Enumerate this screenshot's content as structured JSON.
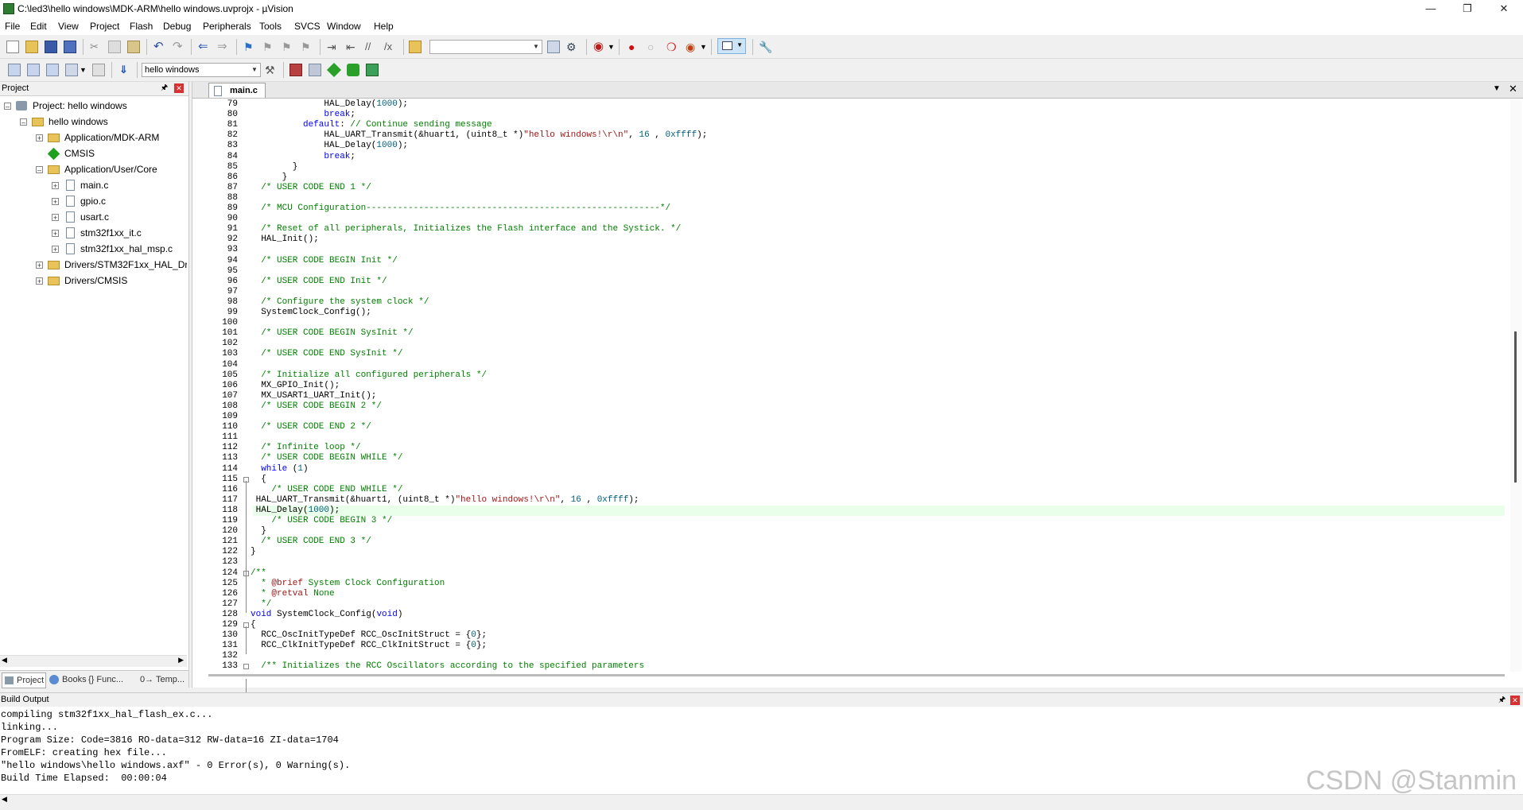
{
  "window": {
    "title": "C:\\led3\\hello windows\\MDK-ARM\\hello windows.uvprojx - µVision"
  },
  "menu": [
    "File",
    "Edit",
    "View",
    "Project",
    "Flash",
    "Debug",
    "Peripherals",
    "Tools",
    "SVCS",
    "Window",
    "Help"
  ],
  "toolbar2": {
    "target_select": "hello windows"
  },
  "project_panel": {
    "title": "Project",
    "tree": {
      "root": "Project: hello windows",
      "target": "hello windows",
      "groups": [
        {
          "label": "Application/MDK-ARM"
        },
        {
          "label": "CMSIS"
        },
        {
          "label": "Application/User/Core",
          "files": [
            "main.c",
            "gpio.c",
            "usart.c",
            "stm32f1xx_it.c",
            "stm32f1xx_hal_msp.c"
          ]
        },
        {
          "label": "Drivers/STM32F1xx_HAL_Driv"
        },
        {
          "label": "Drivers/CMSIS"
        }
      ]
    },
    "bottom_tabs": [
      "Project",
      "Books",
      "{} Func...",
      "0→ Temp..."
    ]
  },
  "editor": {
    "active_tab": "main.c",
    "highlight_line": 118,
    "lines": [
      {
        "n": "79",
        "t": [
          [
            "HAL_Delay(",
            ""
          ],
          [
            "1000",
            "nm"
          ],
          [
            ");",
            ""
          ]
        ],
        "i": 7
      },
      {
        "n": "80",
        "t": [
          [
            "break",
            "kw"
          ],
          [
            ";",
            ""
          ]
        ],
        "i": 7
      },
      {
        "n": "81",
        "t": [
          [
            "default",
            "kw"
          ],
          [
            ": ",
            ""
          ],
          [
            "// Continue sending message",
            "cm"
          ]
        ],
        "i": 5
      },
      {
        "n": "82",
        "t": [
          [
            "HAL_UART_Transmit(&huart1, (uint8_t *)",
            ""
          ],
          [
            "\"hello windows!\\r\\n\"",
            "st"
          ],
          [
            ", ",
            ""
          ],
          [
            "16",
            "nm"
          ],
          [
            " , ",
            ""
          ],
          [
            "0xffff",
            "nm"
          ],
          [
            ");",
            ""
          ]
        ],
        "i": 7
      },
      {
        "n": "83",
        "t": [
          [
            "HAL_Delay(",
            ""
          ],
          [
            "1000",
            "nm"
          ],
          [
            ");",
            ""
          ]
        ],
        "i": 7
      },
      {
        "n": "84",
        "t": [
          [
            "break",
            "kw"
          ],
          [
            ";",
            ""
          ]
        ],
        "i": 7
      },
      {
        "n": "85",
        "t": [
          [
            "}",
            ""
          ]
        ],
        "i": 4
      },
      {
        "n": "86",
        "t": [
          [
            "}",
            ""
          ]
        ],
        "i": 3
      },
      {
        "n": "87",
        "t": [
          [
            "/* USER CODE END 1 */",
            "cm"
          ]
        ],
        "i": 1
      },
      {
        "n": "88",
        "t": [],
        "i": 0
      },
      {
        "n": "89",
        "t": [
          [
            "/* MCU Configuration--------------------------------------------------------*/",
            "cm"
          ]
        ],
        "i": 1
      },
      {
        "n": "90",
        "t": [],
        "i": 0
      },
      {
        "n": "91",
        "t": [
          [
            "/* Reset of all peripherals, Initializes the Flash interface and the Systick. */",
            "cm"
          ]
        ],
        "i": 1
      },
      {
        "n": "92",
        "t": [
          [
            "HAL_Init();",
            ""
          ]
        ],
        "i": 1
      },
      {
        "n": "93",
        "t": [],
        "i": 0
      },
      {
        "n": "94",
        "t": [
          [
            "/* USER CODE BEGIN Init */",
            "cm"
          ]
        ],
        "i": 1
      },
      {
        "n": "95",
        "t": [],
        "i": 0
      },
      {
        "n": "96",
        "t": [
          [
            "/* USER CODE END Init */",
            "cm"
          ]
        ],
        "i": 1
      },
      {
        "n": "97",
        "t": [],
        "i": 0
      },
      {
        "n": "98",
        "t": [
          [
            "/* Configure the system clock */",
            "cm"
          ]
        ],
        "i": 1
      },
      {
        "n": "99",
        "t": [
          [
            "SystemClock_Config();",
            ""
          ]
        ],
        "i": 1
      },
      {
        "n": "100",
        "t": [],
        "i": 0
      },
      {
        "n": "101",
        "t": [
          [
            "/* USER CODE BEGIN SysInit */",
            "cm"
          ]
        ],
        "i": 1
      },
      {
        "n": "102",
        "t": [],
        "i": 0
      },
      {
        "n": "103",
        "t": [
          [
            "/* USER CODE END SysInit */",
            "cm"
          ]
        ],
        "i": 1
      },
      {
        "n": "104",
        "t": [],
        "i": 0
      },
      {
        "n": "105",
        "t": [
          [
            "/* Initialize all configured peripherals */",
            "cm"
          ]
        ],
        "i": 1
      },
      {
        "n": "106",
        "t": [
          [
            "MX_GPIO_Init();",
            ""
          ]
        ],
        "i": 1
      },
      {
        "n": "107",
        "t": [
          [
            "MX_USART1_UART_Init();",
            ""
          ]
        ],
        "i": 1
      },
      {
        "n": "108",
        "t": [
          [
            "/* USER CODE BEGIN 2 */",
            "cm"
          ]
        ],
        "i": 1
      },
      {
        "n": "109",
        "t": [],
        "i": 0
      },
      {
        "n": "110",
        "t": [
          [
            "/* USER CODE END 2 */",
            "cm"
          ]
        ],
        "i": 1
      },
      {
        "n": "111",
        "t": [],
        "i": 0
      },
      {
        "n": "112",
        "t": [
          [
            "/* Infinite loop */",
            "cm"
          ]
        ],
        "i": 1
      },
      {
        "n": "113",
        "t": [
          [
            "/* USER CODE BEGIN WHILE */",
            "cm"
          ]
        ],
        "i": 1
      },
      {
        "n": "114",
        "t": [
          [
            "while",
            "kw"
          ],
          [
            " (",
            ""
          ],
          [
            "1",
            "nm"
          ],
          [
            ")",
            ""
          ]
        ],
        "i": 1
      },
      {
        "n": "115",
        "t": [
          [
            "{",
            ""
          ]
        ],
        "i": 1
      },
      {
        "n": "116",
        "t": [
          [
            "/* USER CODE END WHILE */",
            "cm"
          ]
        ],
        "i": 2
      },
      {
        "n": "117",
        "t": [
          [
            "HAL_UART_Transmit(&huart1, (uint8_t *)",
            ""
          ],
          [
            "\"hello windows!\\r\\n\"",
            "st"
          ],
          [
            ", ",
            ""
          ],
          [
            "16",
            "nm"
          ],
          [
            " , ",
            ""
          ],
          [
            "0xffff",
            "nm"
          ],
          [
            ");",
            ""
          ]
        ],
        "i": 0.5
      },
      {
        "n": "118",
        "t": [
          [
            "HAL_Delay(",
            ""
          ],
          [
            "1000",
            "nm"
          ],
          [
            ");",
            ""
          ]
        ],
        "i": 0.5
      },
      {
        "n": "119",
        "t": [
          [
            "/* USER CODE BEGIN 3 */",
            "cm"
          ]
        ],
        "i": 2
      },
      {
        "n": "120",
        "t": [
          [
            "}",
            ""
          ]
        ],
        "i": 1
      },
      {
        "n": "121",
        "t": [
          [
            "/* USER CODE END 3 */",
            "cm"
          ]
        ],
        "i": 1
      },
      {
        "n": "122",
        "t": [
          [
            "}",
            ""
          ]
        ],
        "i": 0
      },
      {
        "n": "123",
        "t": [],
        "i": 0
      },
      {
        "n": "124",
        "t": [
          [
            "/**",
            "cm"
          ]
        ],
        "i": 0
      },
      {
        "n": "125",
        "t": [
          [
            "  * ",
            "cm"
          ],
          [
            "@brief",
            "st"
          ],
          [
            " System Clock Configuration",
            "cm"
          ]
        ],
        "i": 0
      },
      {
        "n": "126",
        "t": [
          [
            "  * ",
            "cm"
          ],
          [
            "@retval",
            "st"
          ],
          [
            " None",
            "cm"
          ]
        ],
        "i": 0
      },
      {
        "n": "127",
        "t": [
          [
            "  */",
            "cm"
          ]
        ],
        "i": 0
      },
      {
        "n": "128",
        "t": [
          [
            "void",
            "kw"
          ],
          [
            " SystemClock_Config(",
            ""
          ],
          [
            "void",
            "kw"
          ],
          [
            ")",
            ""
          ]
        ],
        "i": 0
      },
      {
        "n": "129",
        "t": [
          [
            "{",
            ""
          ]
        ],
        "i": 0
      },
      {
        "n": "130",
        "t": [
          [
            "RCC_OscInitTypeDef RCC_OscInitStruct = {",
            ""
          ],
          [
            "0",
            "nm"
          ],
          [
            "};",
            ""
          ]
        ],
        "i": 1
      },
      {
        "n": "131",
        "t": [
          [
            "RCC_ClkInitTypeDef RCC_ClkInitStruct = {",
            ""
          ],
          [
            "0",
            "nm"
          ],
          [
            "};",
            ""
          ]
        ],
        "i": 1
      },
      {
        "n": "132",
        "t": [],
        "i": 0
      },
      {
        "n": "133",
        "t": [
          [
            "/** Initializes the RCC Oscillators according to the specified parameters",
            "cm"
          ]
        ],
        "i": 1
      }
    ]
  },
  "build_output": {
    "title": "Build Output",
    "lines": [
      "compiling stm32f1xx_hal_flash_ex.c...",
      "linking...",
      "Program Size: Code=3816 RO-data=312 RW-data=16 ZI-data=1704",
      "FromELF: creating hex file...",
      "\"hello windows\\hello windows.axf\" - 0 Error(s), 0 Warning(s).",
      "Build Time Elapsed:  00:00:04"
    ]
  },
  "watermark": "CSDN @Stanmin"
}
